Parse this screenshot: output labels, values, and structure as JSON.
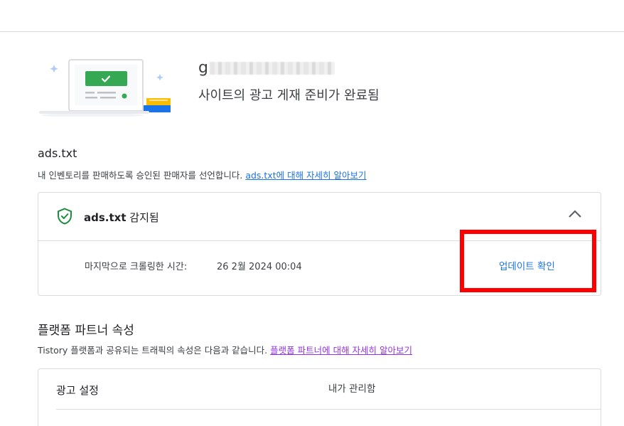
{
  "site": {
    "name_prefix": "g",
    "status": "사이트의 광고 게재 준비가 완료됨"
  },
  "ads_txt": {
    "title": "ads.txt",
    "description": "내 인벤토리를 판매하도록 승인된 판매자를 선언합니다.",
    "learn_more": "ads.txt에 대해 자세히 알아보기",
    "status_name": "ads.txt",
    "status_text": "감지됨",
    "last_crawl_label": "마지막으로 크롤링한 시간:",
    "last_crawl_value": "26 2월 2024 00:04",
    "check_update": "업데이트 확인"
  },
  "platform": {
    "title": "플랫폼 파트너 속성",
    "description": "Tistory 플랫폼과 공유되는 트래픽의 속성은 다음과 같습니다.",
    "learn_more": "플랫폼 파트너에 대해 자세히 알아보기",
    "ad_setting_label": "광고 설정",
    "ad_setting_value": "내가 관리함"
  },
  "icons": {
    "shield": "shield-check-icon",
    "chevron": "chevron-up-icon"
  },
  "colors": {
    "accent": "#1a73e8",
    "success": "#1e8e3e",
    "highlight": "#ff0000",
    "visited_link": "#9334e6"
  }
}
